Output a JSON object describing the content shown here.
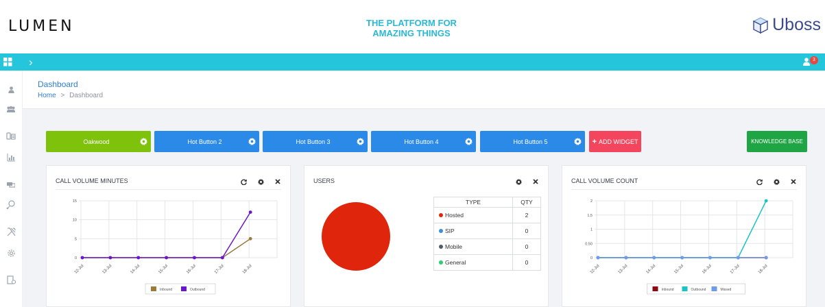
{
  "brand": {
    "left_logo": "LUMEN",
    "tagline_line1": "THE PLATFORM FOR",
    "tagline_line2": "AMAZING THINGS",
    "right_logo": "Uboss"
  },
  "topnav": {
    "notification_count": "3"
  },
  "header": {
    "title": "Dashboard",
    "breadcrumb_home": "Home",
    "breadcrumb_sep": ">",
    "breadcrumb_current": "Dashboard"
  },
  "hot_buttons": [
    {
      "label": "Oakwood",
      "color": "#7ec20c"
    },
    {
      "label": "Hot Button 2",
      "color": "#2b8ae8"
    },
    {
      "label": "Hot Button 3",
      "color": "#2b8ae8"
    },
    {
      "label": "Hot Button 4",
      "color": "#2b8ae8"
    },
    {
      "label": "Hot Button 5",
      "color": "#2b8ae8"
    }
  ],
  "add_widget": {
    "label": "ADD WIDGET",
    "color": "#f4455e"
  },
  "knowledge_base": {
    "label": "KNOWLEDGE BASE",
    "color": "#1fa544"
  },
  "widgets": {
    "call_volume_minutes": {
      "title": "CALL VOLUME MINUTES"
    },
    "users": {
      "title": "USERS",
      "col_type": "TYPE",
      "col_qty": "QTY",
      "rows": [
        {
          "type": "Hosted",
          "qty": "2",
          "color": "#e0250d"
        },
        {
          "type": "SIP",
          "qty": "0",
          "color": "#3a8fd8"
        },
        {
          "type": "Mobile",
          "qty": "0",
          "color": "#555b63"
        },
        {
          "type": "General",
          "qty": "0",
          "color": "#2ecc71"
        }
      ]
    },
    "call_volume_count": {
      "title": "CALL VOLUME COUNT"
    }
  },
  "chart_data": [
    {
      "type": "line",
      "categories": [
        "12-Jul",
        "13-Jul",
        "14-Jul",
        "15-Jul",
        "16-Jul",
        "17-Jul",
        "18-Jul"
      ],
      "series": [
        {
          "name": "Inbound",
          "values": [
            0,
            0,
            0,
            0,
            0,
            0,
            5
          ],
          "color": "#9c7a3c"
        },
        {
          "name": "Outbound",
          "values": [
            0,
            0,
            0,
            0,
            0,
            0,
            12
          ],
          "color": "#6a16c9"
        }
      ],
      "yticks": [
        "0",
        "5",
        "10",
        "15"
      ],
      "ylim": [
        0,
        15
      ],
      "grid": true,
      "legend": "bottom"
    },
    {
      "type": "pie",
      "slices": [
        {
          "name": "Hosted",
          "value": 2,
          "color": "#e0250d"
        }
      ]
    },
    {
      "type": "line",
      "categories": [
        "12-Jul",
        "13-Jul",
        "14-Jul",
        "15-Jul",
        "16-Jul",
        "17-Jul",
        "18-Jul"
      ],
      "series": [
        {
          "name": "Inbound",
          "values": [
            0,
            0,
            0,
            0,
            0,
            0,
            0
          ],
          "color": "#8b0a14"
        },
        {
          "name": "Outbound",
          "values": [
            0,
            0,
            0,
            0,
            0,
            0,
            2
          ],
          "color": "#1dc3c3"
        },
        {
          "name": "Missed",
          "values": [
            0,
            0,
            0,
            0,
            0,
            0,
            0
          ],
          "color": "#6f9ce8"
        }
      ],
      "yticks": [
        "0",
        "0.50",
        "1",
        "1.5",
        "2"
      ],
      "ylim": [
        0,
        2
      ],
      "grid": true,
      "legend": "bottom"
    }
  ]
}
